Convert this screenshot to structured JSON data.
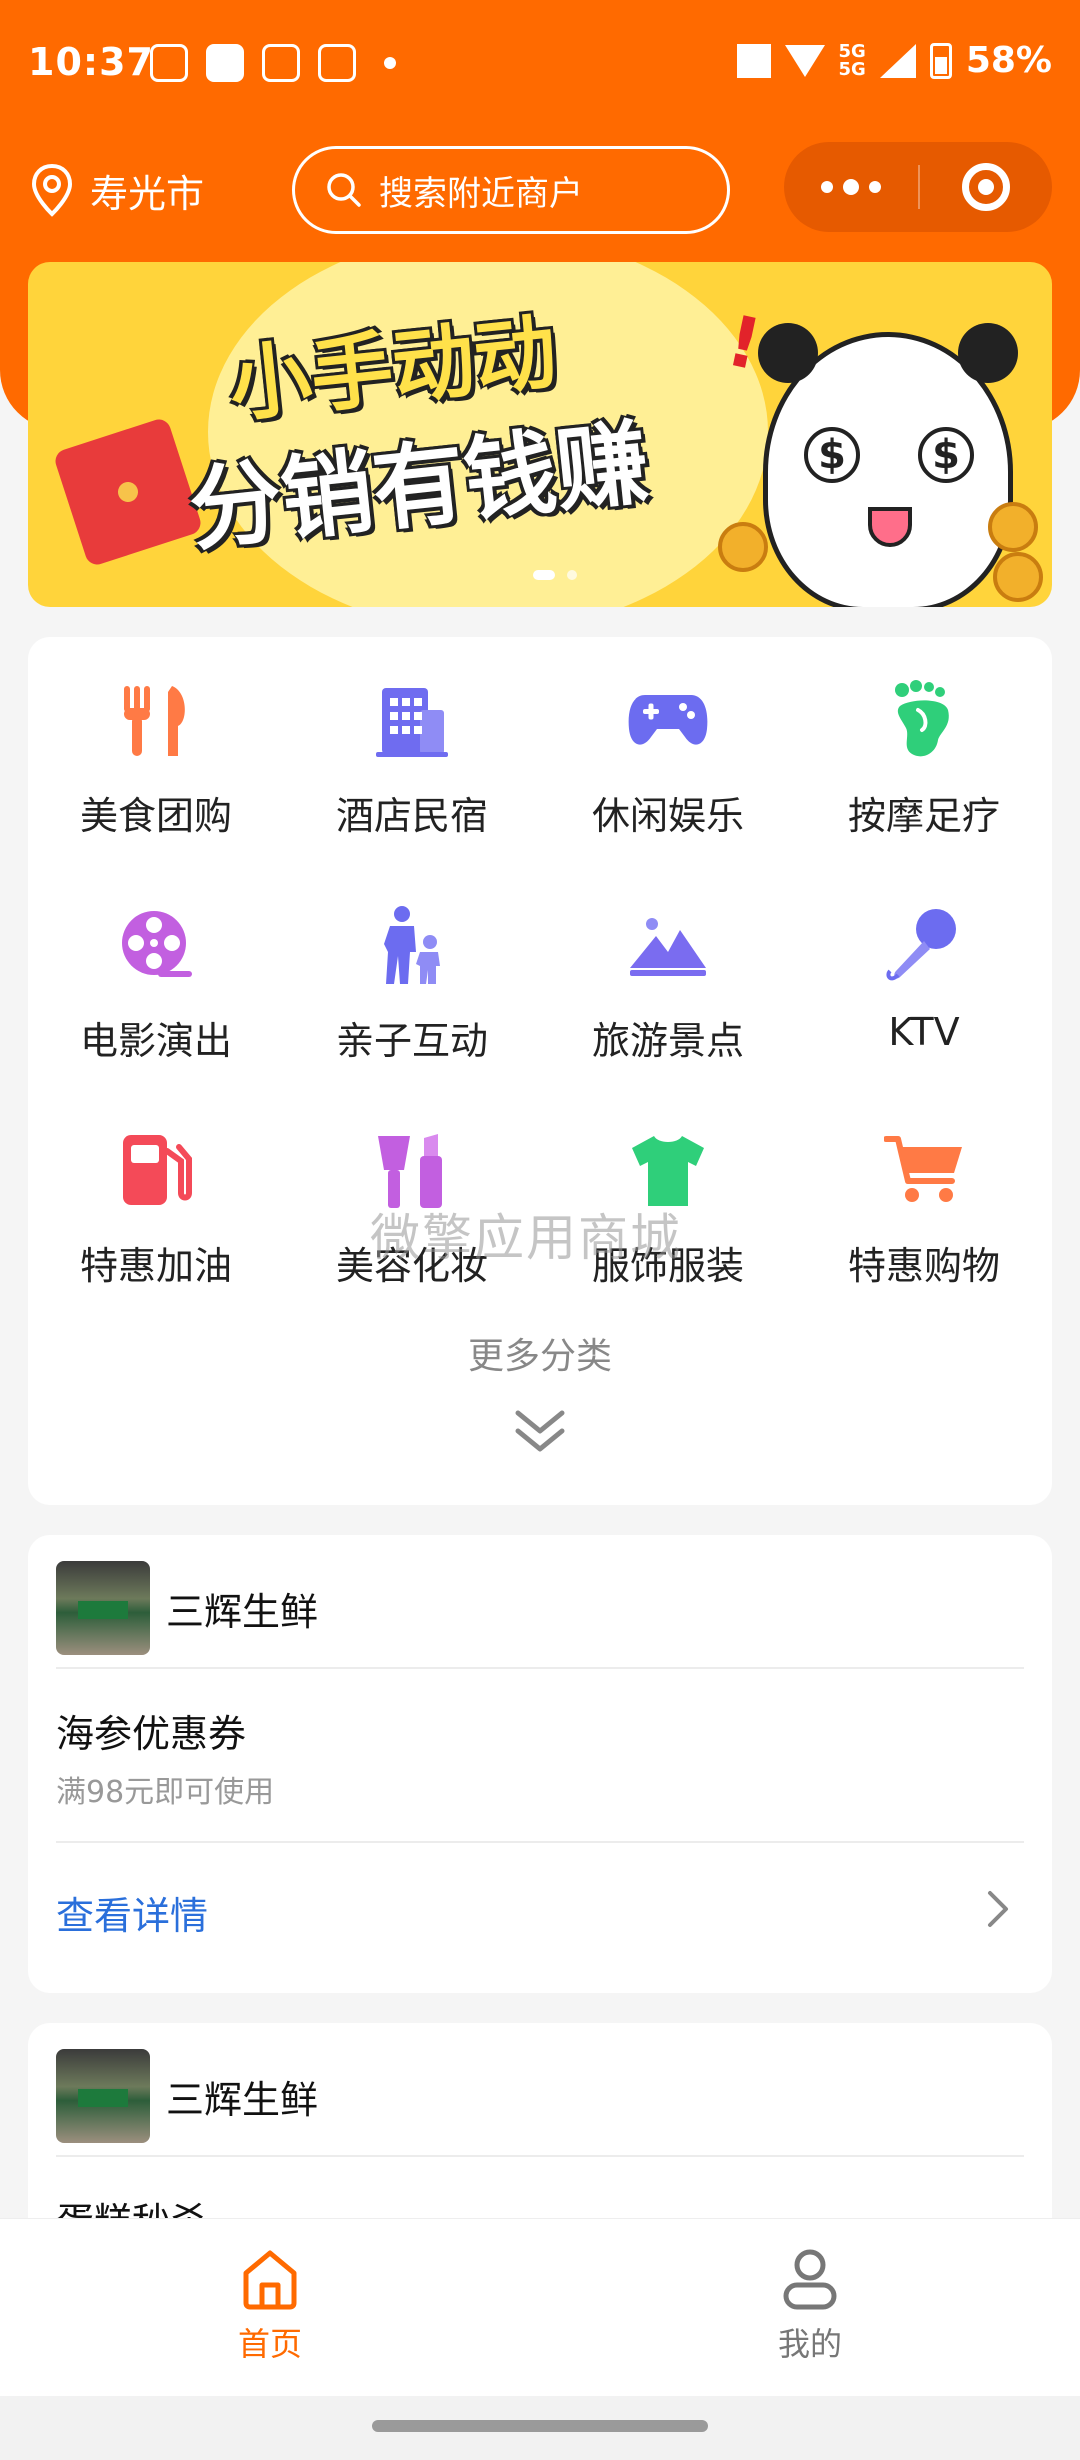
{
  "status_bar": {
    "time": "10:37",
    "network": "5G",
    "battery": "58%"
  },
  "header": {
    "location": "寿光市",
    "search_placeholder": "搜索附近商户"
  },
  "banner": {
    "line1": "小手动动",
    "line2": "分销有钱赚",
    "exclaim": "!",
    "panda_eye": "$"
  },
  "categories": [
    {
      "label": "美食团购",
      "icon": "food-icon",
      "color": "#ff7a45"
    },
    {
      "label": "酒店民宿",
      "icon": "hotel-icon",
      "color": "#6f6cf0"
    },
    {
      "label": "休闲娱乐",
      "icon": "gamepad-icon",
      "color": "#6c6cf0"
    },
    {
      "label": "按摩足疗",
      "icon": "foot-icon",
      "color": "#2fcf7a"
    },
    {
      "label": "电影演出",
      "icon": "film-reel-icon",
      "color": "#c25fe0"
    },
    {
      "label": "亲子互动",
      "icon": "parent-child-icon",
      "color": "#6c6cf0"
    },
    {
      "label": "旅游景点",
      "icon": "mountain-icon",
      "color": "#7a6cf0"
    },
    {
      "label": "KTV",
      "icon": "microphone-icon",
      "color": "#6c6cf0"
    },
    {
      "label": "特惠加油",
      "icon": "gas-pump-icon",
      "color": "#f44a58"
    },
    {
      "label": "美容化妆",
      "icon": "cosmetics-icon",
      "color": "#c25fe0"
    },
    {
      "label": "服饰服装",
      "icon": "tshirt-icon",
      "color": "#2fcf7a"
    },
    {
      "label": "特惠购物",
      "icon": "cart-icon",
      "color": "#ff7a45"
    }
  ],
  "more_categories": "更多分类",
  "watermark": "微擎应用商城",
  "coupons": [
    {
      "store": "三辉生鲜",
      "title": "海参优惠券",
      "condition": "满98元即可使用",
      "link": "查看详情"
    },
    {
      "store": "三辉生鲜",
      "title": "蛋糕秒杀"
    }
  ],
  "tabbar": {
    "home": "首页",
    "me": "我的"
  },
  "colors": {
    "brand": "#ff6a00",
    "link": "#2a6fdb"
  }
}
